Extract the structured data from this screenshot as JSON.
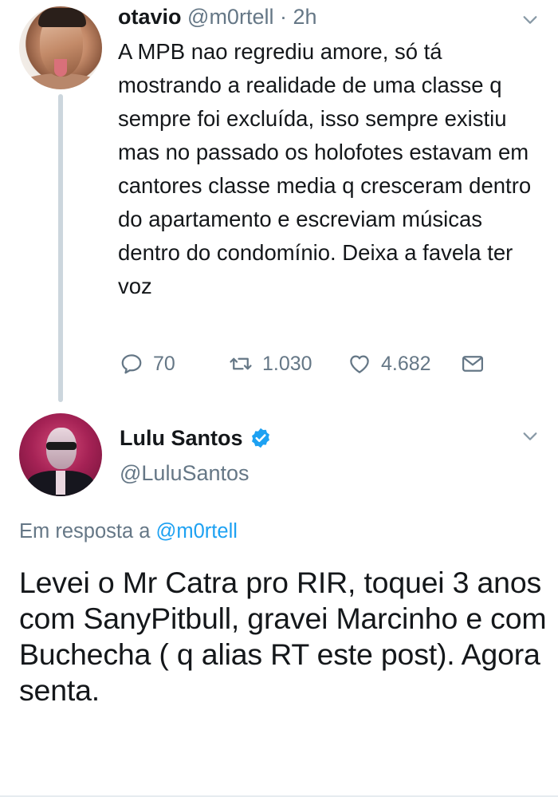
{
  "tweet1": {
    "name": "otavio",
    "handle": "@m0rtell",
    "separator": "·",
    "time": "2h",
    "text": "A MPB nao regrediu amore, só tá mostrando a realidade de uma classe q sempre foi excluída, isso sempre existiu mas no passado os holofotes estavam em cantores classe media q cresceram dentro do apartamento e escreviam músicas dentro do condomínio. Deixa a favela ter voz",
    "replies": "70",
    "retweets": "1.030",
    "likes": "4.682"
  },
  "tweet2": {
    "name": "Lulu Santos",
    "handle": "@LuluSantos",
    "reply_prefix": "Em resposta a",
    "reply_to": "@m0rtell",
    "text": "Levei o Mr Catra pro RIR, toquei 3 anos com SanyPitbull, gravei Marcinho e com Buchecha ( q alias RT este post). Agora senta."
  },
  "colors": {
    "text": "#14171a",
    "secondary": "#657786",
    "link": "#1da1f2",
    "thread_line": "#ccd6dd"
  },
  "icons": [
    "reply-icon",
    "retweet-icon",
    "like-icon",
    "direct-message-icon",
    "chevron-down-icon",
    "verified-badge-icon"
  ]
}
